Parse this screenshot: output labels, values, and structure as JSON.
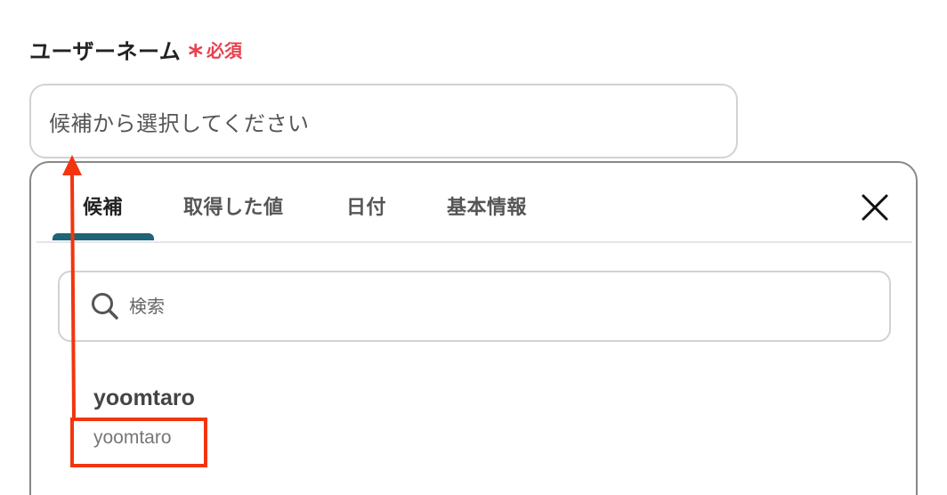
{
  "field": {
    "label": "ユーザーネーム",
    "required_star": "*",
    "required_text": "必須",
    "placeholder": "候補から選択してください"
  },
  "dropdown": {
    "tabs": [
      {
        "label": "候補",
        "active": true
      },
      {
        "label": "取得した値",
        "active": false
      },
      {
        "label": "日付",
        "active": false
      },
      {
        "label": "基本情報",
        "active": false
      }
    ],
    "close_icon": "close-icon",
    "search": {
      "icon": "search-icon",
      "placeholder": "検索"
    },
    "options": [
      {
        "title": "yoomtaro",
        "subtitle": "yoomtaro"
      }
    ]
  },
  "colors": {
    "required": "#e8414f",
    "tab_indicator": "#1f6478",
    "annotation": "#f2350f"
  }
}
